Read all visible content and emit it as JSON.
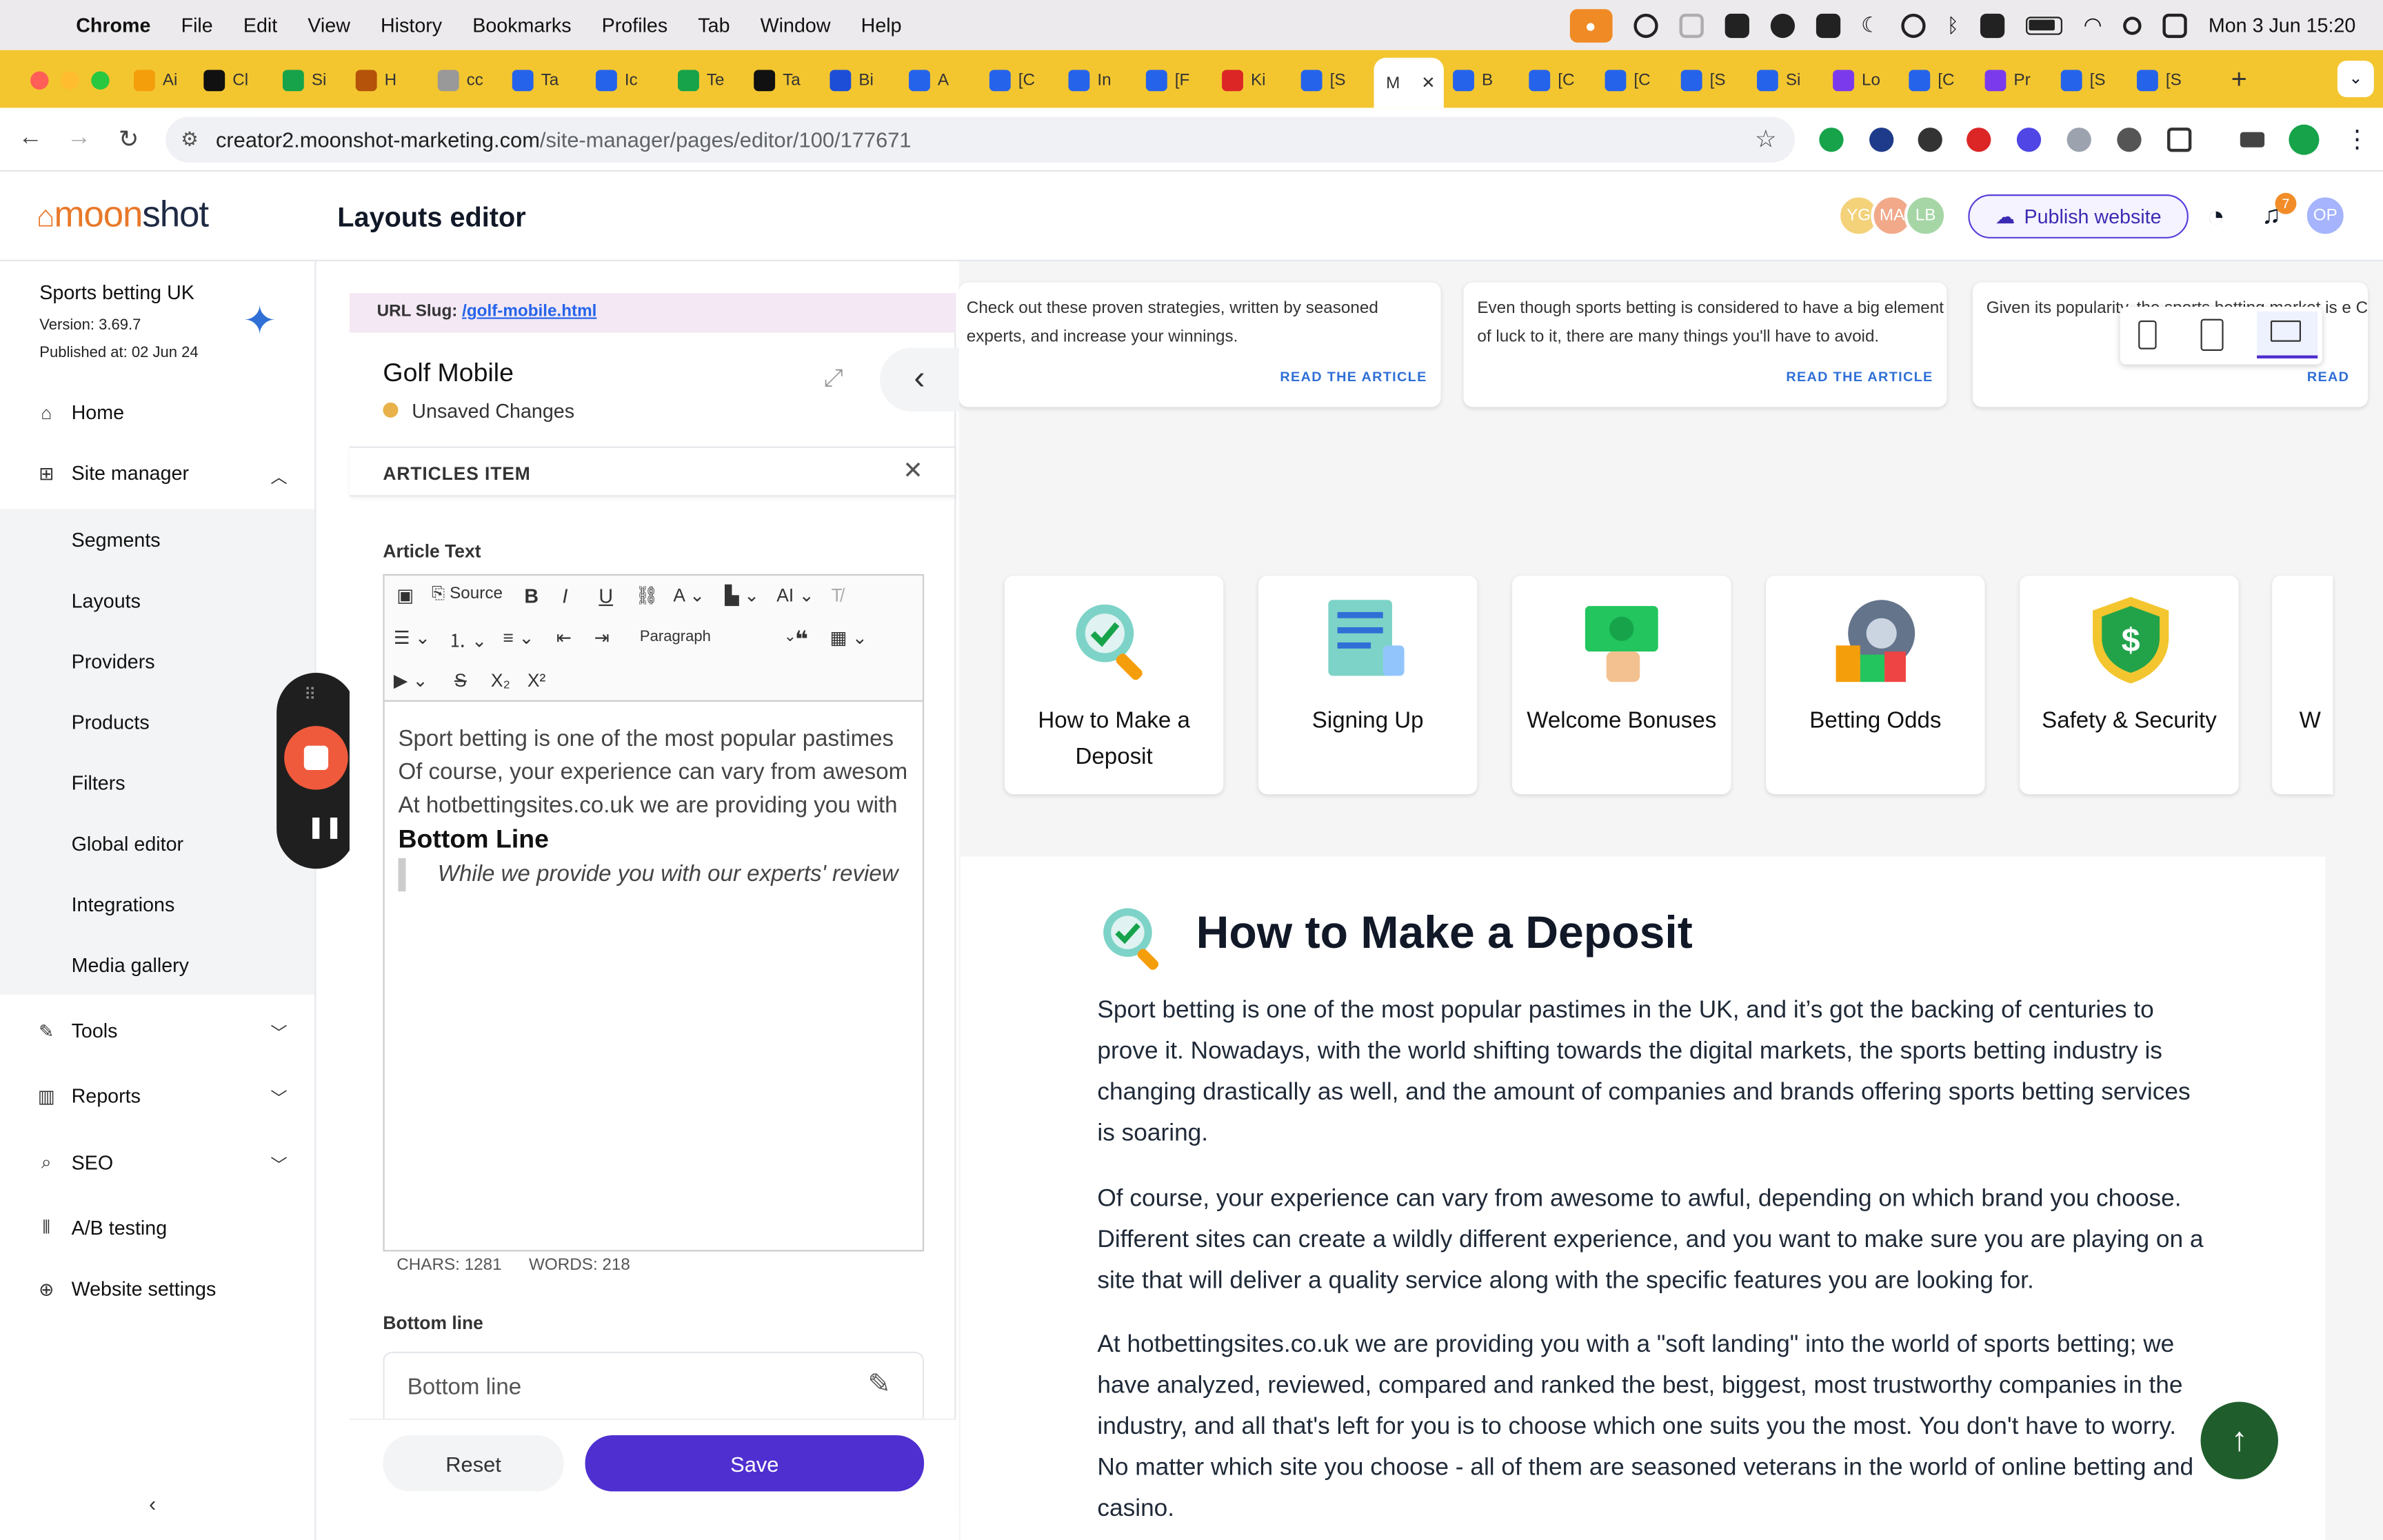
{
  "menubar": {
    "app": "Chrome",
    "items": [
      "File",
      "Edit",
      "View",
      "History",
      "Bookmarks",
      "Profiles",
      "Tab",
      "Window",
      "Help"
    ],
    "datetime": "Mon 3 Jun  15:20"
  },
  "tabs": [
    {
      "label": "Ai",
      "color": "#f59e0b"
    },
    {
      "label": "Cl",
      "color": "#111"
    },
    {
      "label": "Si",
      "color": "#16a34a"
    },
    {
      "label": "H",
      "color": "#b45309"
    },
    {
      "label": "cc",
      "color": "#999"
    },
    {
      "label": "Ta",
      "color": "#2563eb"
    },
    {
      "label": "Ic",
      "color": "#2563eb"
    },
    {
      "label": "Te",
      "color": "#16a34a"
    },
    {
      "label": "Ta",
      "color": "#111"
    },
    {
      "label": "Bi",
      "color": "#1d4ed8"
    },
    {
      "label": "A",
      "color": "#2563eb"
    },
    {
      "label": "[C",
      "color": "#2563eb"
    },
    {
      "label": "In",
      "color": "#2563eb"
    },
    {
      "label": "[F",
      "color": "#2563eb"
    },
    {
      "label": "Ki",
      "color": "#dc2626"
    },
    {
      "label": "[S",
      "color": "#2563eb"
    },
    {
      "label": "M",
      "color": "#fff"
    },
    {
      "label": "B",
      "color": "#2563eb"
    },
    {
      "label": "[C",
      "color": "#2563eb"
    },
    {
      "label": "[C",
      "color": "#2563eb"
    },
    {
      "label": "[S",
      "color": "#2563eb"
    },
    {
      "label": "Si",
      "color": "#2563eb"
    },
    {
      "label": "Lo",
      "color": "#7c3aed"
    },
    {
      "label": "[C",
      "color": "#2563eb"
    },
    {
      "label": "Pr",
      "color": "#7c3aed"
    },
    {
      "label": "[S",
      "color": "#2563eb"
    },
    {
      "label": "[S",
      "color": "#2563eb"
    }
  ],
  "url": {
    "host": "creator2.moonshot-marketing.com",
    "path": "/site-manager/pages/editor/100/177671"
  },
  "header": {
    "logo_a": "moon",
    "logo_b": "shot",
    "title": "Layouts editor",
    "avatars": [
      "YG",
      "MA",
      "LB"
    ],
    "publish": "Publish website",
    "notif_count": "7",
    "user": "OP"
  },
  "sidebar": {
    "site_name": "Sports betting UK",
    "version": "Version: 3.69.7",
    "published": "Published at: 02 Jun 24",
    "home": "Home",
    "site_manager": "Site manager",
    "sub": [
      "Segments",
      "Layouts",
      "Providers",
      "Products",
      "Filters",
      "Global editor",
      "Integrations",
      "Media gallery"
    ],
    "tools": "Tools",
    "reports": "Reports",
    "seo": "SEO",
    "ab": "A/B testing",
    "settings": "Website settings"
  },
  "panel": {
    "slug_label": "URL Slug:",
    "slug": "/golf-mobile.html",
    "page_name": "Golf Mobile",
    "status": "Unsaved Changes",
    "section": "ARTICLES ITEM",
    "field_label": "Article Text",
    "source": "Source",
    "paragraph": "Paragraph",
    "editor_lines": [
      "Sport betting is one of the most popular pastimes",
      "Of course, your experience can vary from awesom",
      "At hotbettingsites.co.uk we are providing you with"
    ],
    "editor_heading": "Bottom Line",
    "editor_quote": "While we provide you with our experts' review",
    "chars": "CHARS: 1281",
    "words": "WORDS: 218",
    "bottom_label": "Bottom line",
    "bottom_placeholder": "Bottom line",
    "reset": "Reset",
    "save": "Save"
  },
  "preview": {
    "articles": [
      {
        "text": "Check out these proven strategies, written by seasoned experts, and increase your winnings.",
        "read": "READ THE ARTICLE"
      },
      {
        "text": "Even though sports betting is considered to have a big element of luck to it, there are many things you'll have to avoid.",
        "read": "READ THE ARTICLE"
      },
      {
        "text": "Given its popularity, the sports betting market is e Check this out to s",
        "read": "READ"
      }
    ],
    "tiles": [
      "How to Make a Deposit",
      "Signing Up",
      "Welcome Bonuses",
      "Betting Odds",
      "Safety & Security",
      "W"
    ],
    "heading": "How to Make a Deposit",
    "paragraphs": [
      "Sport betting is one of the most popular pastimes in the UK, and it’s got the backing of centuries to prove it. Nowadays, with the world shifting towards the digital markets, the sports betting industry is changing drastically as well, and the amount of companies and brands offering sports betting services is soaring.",
      "Of course, your experience can vary from awesome to awful, depending on which brand you choose. Different sites can create a wildly different experience, and you want to make sure you are playing on a site that will deliver a quality service along with the specific features you are looking for.",
      "At hotbettingsites.co.uk we are providing you with a \"soft landing\" into the world of sports betting; we have analyzed, reviewed, compared and ranked the best, biggest, most trustworthy companies in the industry, and all that's left for you is to choose which one suits you the most. You don't have to worry. No matter which site you choose - all of them are seasoned veterans in the world of online betting and casino."
    ]
  },
  "colors": {
    "accent": "#4f2fd0",
    "tabbar": "#f3c630",
    "scroll_top": "#1f5e2c",
    "record": "#ef5a3c"
  }
}
